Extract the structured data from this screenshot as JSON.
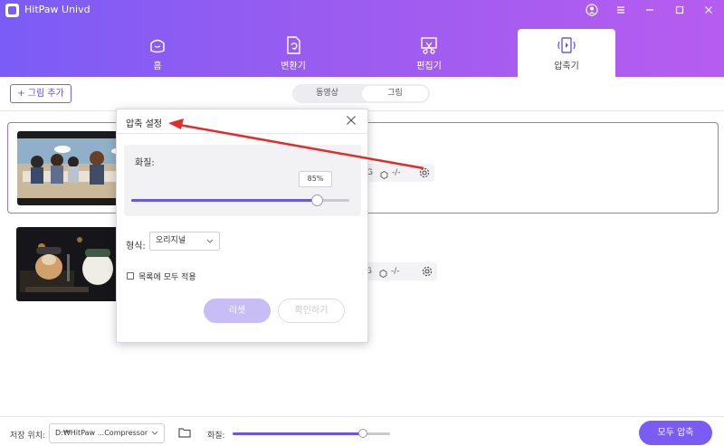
{
  "app": {
    "title": "HitPaw Univd"
  },
  "tabs": [
    {
      "label": "홈",
      "icon": "home-icon"
    },
    {
      "label": "변환기",
      "icon": "converter-icon"
    },
    {
      "label": "편집기",
      "icon": "editor-icon"
    },
    {
      "label": "압축기",
      "icon": "compressor-icon",
      "active": true
    }
  ],
  "toolbar": {
    "add_label": "+ 그림 추가",
    "segments": [
      "동영상",
      "그림"
    ],
    "active_segment": "그림"
  },
  "files": [
    {
      "meta_prefix": "G",
      "meta_size": "-/-"
    },
    {
      "meta_prefix": "G",
      "meta_size": "-/-"
    }
  ],
  "dialog": {
    "title": "압축 설정",
    "quality_label": "화질:",
    "quality_value": "85%",
    "quality_level": 0.85,
    "format_label": "형식:",
    "format_value": "오리지널",
    "apply_all_label": "목록에 모두 적용",
    "apply_all_checked": false,
    "reset_label": "리셋",
    "confirm_label": "확인하기"
  },
  "bottom": {
    "save_label": "저장 위치:",
    "save_path": "D:₩HitPaw ...Compressor",
    "quality_label": "화질:",
    "quality_level": 0.83,
    "compress_all_label": "모두 압축"
  },
  "colors": {
    "accent": "#7a5cf4",
    "header_start": "#7b5cf6",
    "header_end": "#b75cf0",
    "arrow": "#e32b2b"
  }
}
